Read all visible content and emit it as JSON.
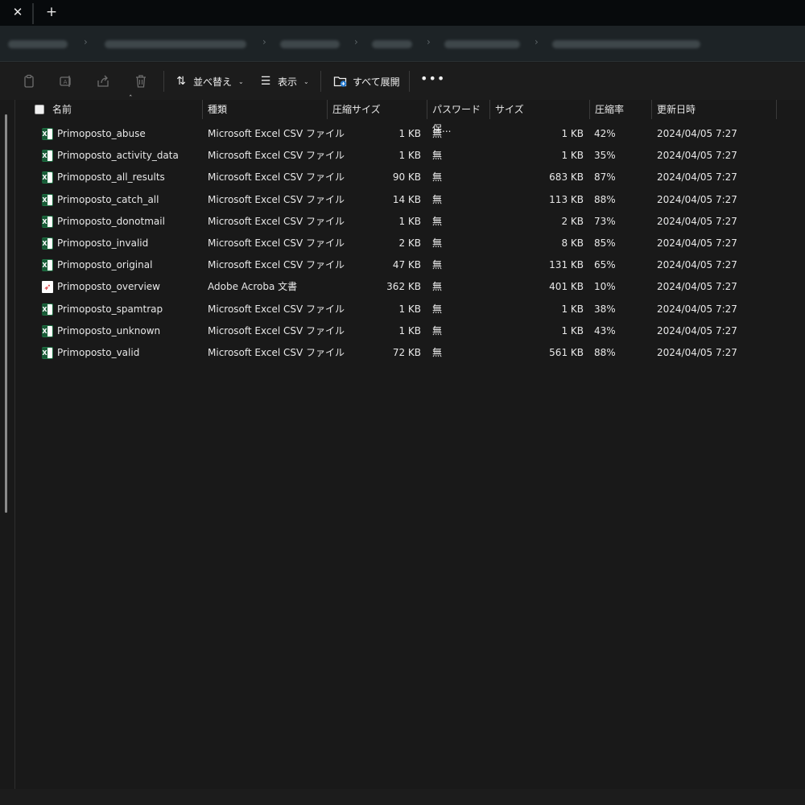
{
  "tabs": {
    "close_icon": "✕",
    "new_tab_icon": "+"
  },
  "toolbar": {
    "paste_icon": "paste-icon",
    "rename_icon": "rename-icon",
    "share_icon": "share-icon",
    "delete_icon": "delete-icon",
    "sort_label": "並べ替え",
    "view_label": "表示",
    "expand_all_label": "すべて展開",
    "more_label": "•••"
  },
  "columns": {
    "name": "名前",
    "type": "種類",
    "compressed_size": "圧縮サイズ",
    "password": "パスワード保...",
    "size": "サイズ",
    "ratio": "圧縮率",
    "modified": "更新日時"
  },
  "files": [
    {
      "name": "Primoposto_abuse",
      "type": "Microsoft Excel CSV ファイル",
      "compressed": "1 KB",
      "password": "無",
      "size": "1 KB",
      "ratio": "42%",
      "modified": "2024/04/05 7:27",
      "icon": "excel-icon"
    },
    {
      "name": "Primoposto_activity_data",
      "type": "Microsoft Excel CSV ファイル",
      "compressed": "1 KB",
      "password": "無",
      "size": "1 KB",
      "ratio": "35%",
      "modified": "2024/04/05 7:27",
      "icon": "excel-icon"
    },
    {
      "name": "Primoposto_all_results",
      "type": "Microsoft Excel CSV ファイル",
      "compressed": "90 KB",
      "password": "無",
      "size": "683 KB",
      "ratio": "87%",
      "modified": "2024/04/05 7:27",
      "icon": "excel-icon"
    },
    {
      "name": "Primoposto_catch_all",
      "type": "Microsoft Excel CSV ファイル",
      "compressed": "14 KB",
      "password": "無",
      "size": "113 KB",
      "ratio": "88%",
      "modified": "2024/04/05 7:27",
      "icon": "excel-icon"
    },
    {
      "name": "Primoposto_donotmail",
      "type": "Microsoft Excel CSV ファイル",
      "compressed": "1 KB",
      "password": "無",
      "size": "2 KB",
      "ratio": "73%",
      "modified": "2024/04/05 7:27",
      "icon": "excel-icon"
    },
    {
      "name": "Primoposto_invalid",
      "type": "Microsoft Excel CSV ファイル",
      "compressed": "2 KB",
      "password": "無",
      "size": "8 KB",
      "ratio": "85%",
      "modified": "2024/04/05 7:27",
      "icon": "excel-icon"
    },
    {
      "name": "Primoposto_original",
      "type": "Microsoft Excel CSV ファイル",
      "compressed": "47 KB",
      "password": "無",
      "size": "131 KB",
      "ratio": "65%",
      "modified": "2024/04/05 7:27",
      "icon": "excel-icon"
    },
    {
      "name": "Primoposto_overview",
      "type": "Adobe Acroba 文書",
      "compressed": "362 KB",
      "password": "無",
      "size": "401 KB",
      "ratio": "10%",
      "modified": "2024/04/05 7:27",
      "icon": "pdf-icon"
    },
    {
      "name": "Primoposto_spamtrap",
      "type": "Microsoft Excel CSV ファイル",
      "compressed": "1 KB",
      "password": "無",
      "size": "1 KB",
      "ratio": "38%",
      "modified": "2024/04/05 7:27",
      "icon": "excel-icon"
    },
    {
      "name": "Primoposto_unknown",
      "type": "Microsoft Excel CSV ファイル",
      "compressed": "1 KB",
      "password": "無",
      "size": "1 KB",
      "ratio": "43%",
      "modified": "2024/04/05 7:27",
      "icon": "excel-icon"
    },
    {
      "name": "Primoposto_valid",
      "type": "Microsoft Excel CSV ファイル",
      "compressed": "72 KB",
      "password": "無",
      "size": "561 KB",
      "ratio": "88%",
      "modified": "2024/04/05 7:27",
      "icon": "excel-icon"
    }
  ],
  "colors": {
    "background": "#191919",
    "toolbar": "#1c1c1c",
    "tabstrip": "#070a0c",
    "addressbar": "#1d2326",
    "excel": "#1f7244",
    "pdf": "#d7252a"
  }
}
